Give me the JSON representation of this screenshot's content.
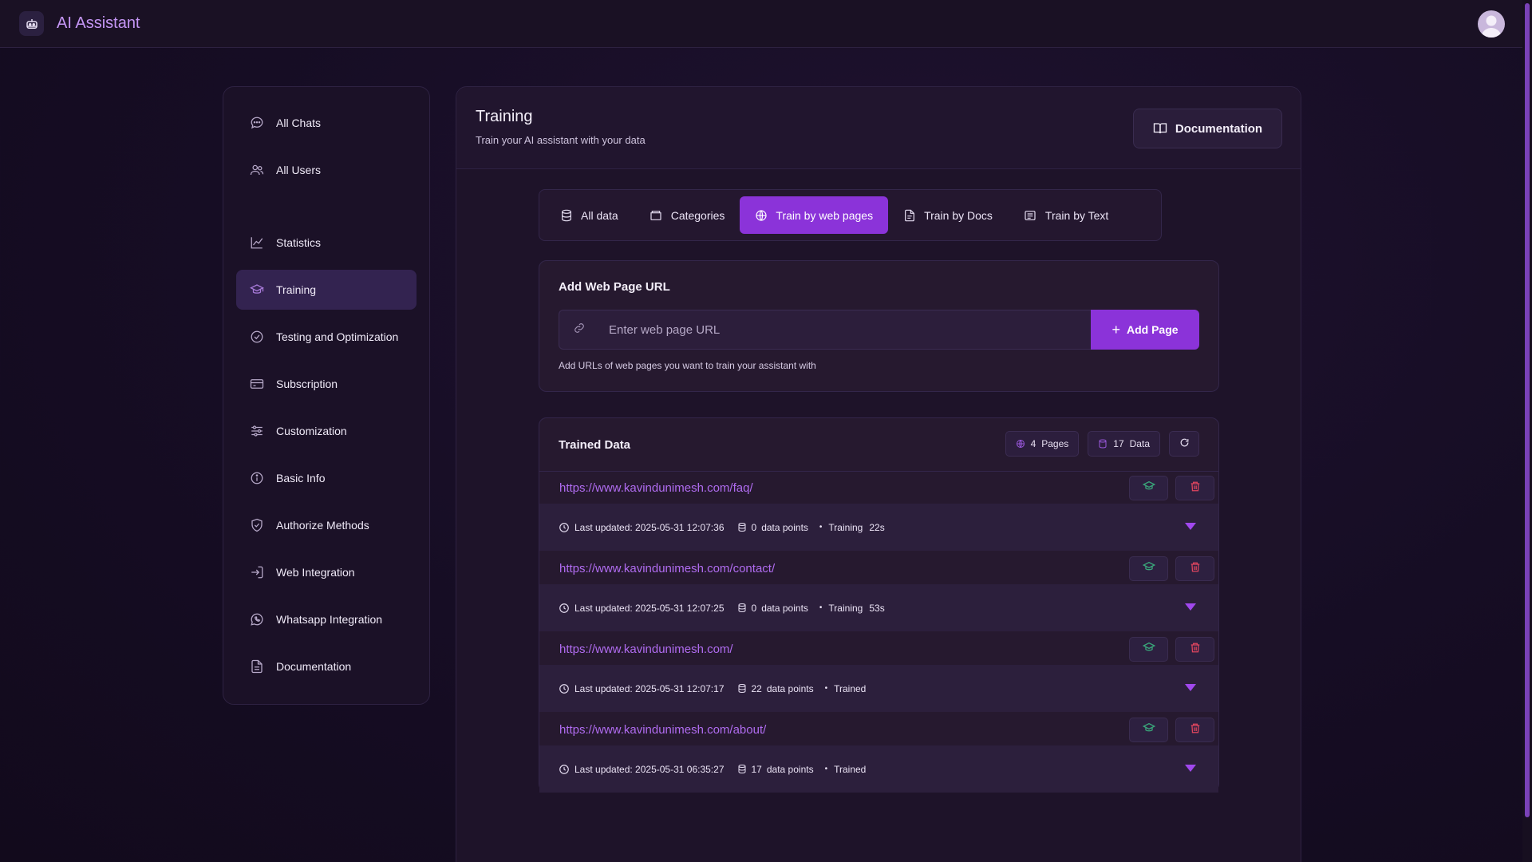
{
  "app": {
    "title": "AI Assistant"
  },
  "sidebar": {
    "items": [
      {
        "label": "All Chats",
        "icon": "chat-icon"
      },
      {
        "label": "All Users",
        "icon": "users-icon"
      },
      {
        "label": "Statistics",
        "icon": "chart-icon"
      },
      {
        "label": "Training",
        "icon": "graduation-cap-icon",
        "active": true
      },
      {
        "label": "Testing and Optimization",
        "icon": "check-circle-icon"
      },
      {
        "label": "Subscription",
        "icon": "credit-card-icon"
      },
      {
        "label": "Customization",
        "icon": "sliders-icon"
      },
      {
        "label": "Basic Info",
        "icon": "info-icon"
      },
      {
        "label": "Authorize Methods",
        "icon": "shield-check-icon"
      },
      {
        "label": "Web Integration",
        "icon": "login-icon"
      },
      {
        "label": "Whatsapp Integration",
        "icon": "whatsapp-icon"
      },
      {
        "label": "Documentation",
        "icon": "document-icon"
      }
    ]
  },
  "header": {
    "title": "Training",
    "subtitle": "Train your AI assistant with your data",
    "doc_button": "Documentation"
  },
  "tabs": [
    {
      "label": "All data",
      "icon": "database-icon"
    },
    {
      "label": "Categories",
      "icon": "folder-icon"
    },
    {
      "label": "Train by web pages",
      "icon": "globe-icon",
      "active": true
    },
    {
      "label": "Train by Docs",
      "icon": "file-icon"
    },
    {
      "label": "Train by Text",
      "icon": "text-icon"
    }
  ],
  "add_url": {
    "title": "Add Web Page URL",
    "placeholder": "Enter web page URL",
    "button": "Add Page",
    "hint": "Add URLs of web pages you want to train your assistant with"
  },
  "trained": {
    "title": "Trained Data",
    "pages_count": "4",
    "pages_label": "Pages",
    "data_count": "17",
    "data_label": "Data",
    "entries": [
      {
        "url": "https://www.kavindunimesh.com/faq/",
        "updated": "Last updated: 2025-05-31 12:07:36",
        "points": "0",
        "points_label": "data points",
        "status": "Training",
        "time": "22s"
      },
      {
        "url": "https://www.kavindunimesh.com/contact/",
        "updated": "Last updated: 2025-05-31 12:07:25",
        "points": "0",
        "points_label": "data points",
        "status": "Training",
        "time": "53s"
      },
      {
        "url": "https://www.kavindunimesh.com/",
        "updated": "Last updated: 2025-05-31 12:07:17",
        "points": "22",
        "points_label": "data points",
        "status": "Trained",
        "time": ""
      },
      {
        "url": "https://www.kavindunimesh.com/about/",
        "updated": "Last updated: 2025-05-31 06:35:27",
        "points": "17",
        "points_label": "data points",
        "status": "Trained",
        "time": ""
      }
    ]
  },
  "colors": {
    "accent": "#8b33d9",
    "link": "#b06cf0",
    "train_icon": "#3aa57a",
    "delete_icon": "#e0455f"
  }
}
